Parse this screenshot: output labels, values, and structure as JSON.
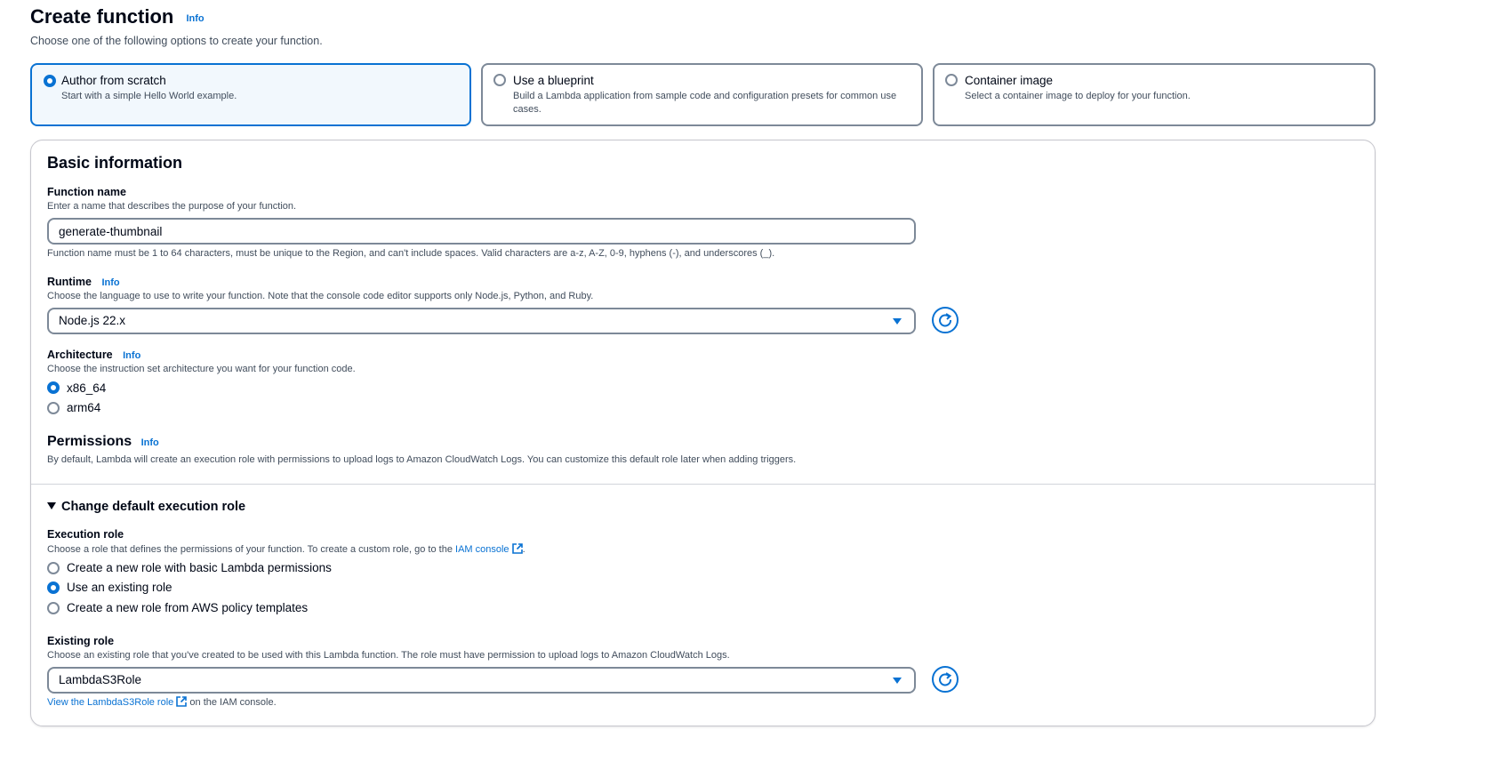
{
  "header": {
    "title": "Create function",
    "info": "Info",
    "subtitle": "Choose one of the following options to create your function."
  },
  "options": [
    {
      "title": "Author from scratch",
      "desc": "Start with a simple Hello World example.",
      "selected": true
    },
    {
      "title": "Use a blueprint",
      "desc": "Build a Lambda application from sample code and configuration presets for common use cases.",
      "selected": false
    },
    {
      "title": "Container image",
      "desc": "Select a container image to deploy for your function.",
      "selected": false
    }
  ],
  "basic": {
    "heading": "Basic information",
    "function_name": {
      "label": "Function name",
      "description": "Enter a name that describes the purpose of your function.",
      "value": "generate-thumbnail",
      "constraint": "Function name must be 1 to 64 characters, must be unique to the Region, and can't include spaces. Valid characters are a-z, A-Z, 0-9, hyphens (-), and underscores (_)."
    },
    "runtime": {
      "label": "Runtime",
      "info": "Info",
      "description": "Choose the language to use to write your function. Note that the console code editor supports only Node.js, Python, and Ruby.",
      "value": "Node.js 22.x"
    },
    "architecture": {
      "label": "Architecture",
      "info": "Info",
      "description": "Choose the instruction set architecture you want for your function code.",
      "options": [
        "x86_64",
        "arm64"
      ],
      "selected": "x86_64"
    },
    "permissions": {
      "heading": "Permissions",
      "info": "Info",
      "description": "By default, Lambda will create an execution role with permissions to upload logs to Amazon CloudWatch Logs. You can customize this default role later when adding triggers."
    }
  },
  "execution": {
    "expander": "Change default execution role",
    "role_label": "Execution role",
    "role_desc": "Choose a role that defines the permissions of your function. To create a custom role, go to the",
    "iam_link": "IAM console",
    "period": ".",
    "role_options": [
      "Create a new role with basic Lambda permissions",
      "Use an existing role",
      "Create a new role from AWS policy templates"
    ],
    "role_selected": "Use an existing role",
    "existing_label": "Existing role",
    "existing_desc": "Choose an existing role that you've created to be used with this Lambda function. The role must have permission to upload logs to Amazon CloudWatch Logs.",
    "existing_value": "LambdaS3Role",
    "view_link": "View the LambdaS3Role role",
    "view_suffix": "on the IAM console."
  },
  "colors": {
    "accent": "#0972d3",
    "text": "#000716",
    "muted": "#414d5c",
    "border": "#7d8998"
  },
  "icons": [
    "refresh-icon",
    "external-link-icon",
    "caret-down-icon",
    "triangle-down-icon"
  ]
}
